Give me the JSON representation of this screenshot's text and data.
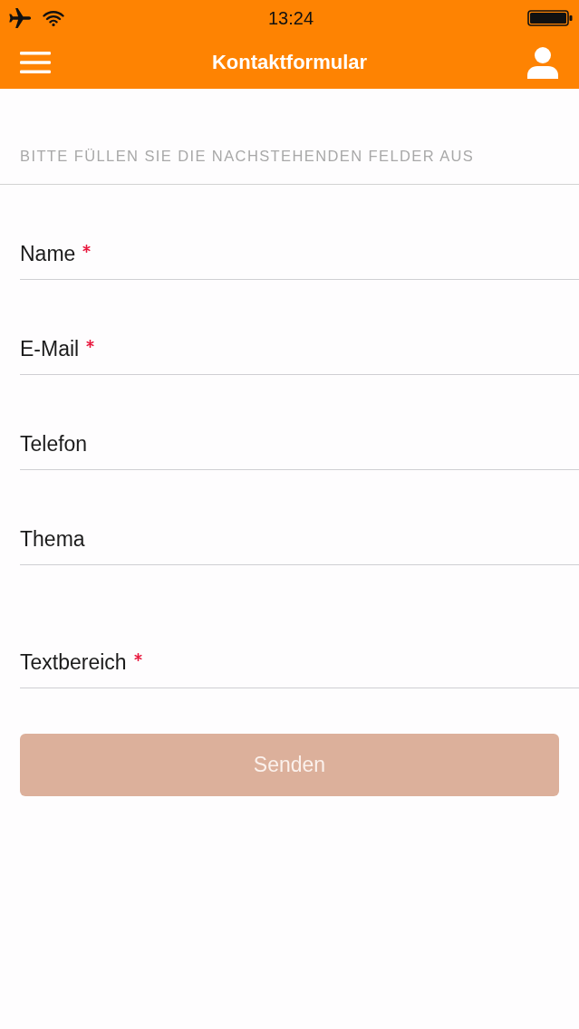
{
  "status_bar": {
    "time": "13:24"
  },
  "nav_bar": {
    "title": "Kontaktformular"
  },
  "form": {
    "heading": "BITTE FÜLLEN SIE DIE NACHSTEHENDEN FELDER AUS",
    "fields": [
      {
        "kind": "text",
        "label": "Name",
        "required": true
      },
      {
        "kind": "text",
        "label": "E-Mail",
        "required": true
      },
      {
        "kind": "text",
        "label": "Telefon",
        "required": false
      },
      {
        "kind": "text",
        "label": "Thema",
        "required": false
      },
      {
        "kind": "textarea",
        "label": "Textbereich",
        "required": true
      }
    ],
    "submit": {
      "label": "Senden",
      "disabled": true
    }
  }
}
